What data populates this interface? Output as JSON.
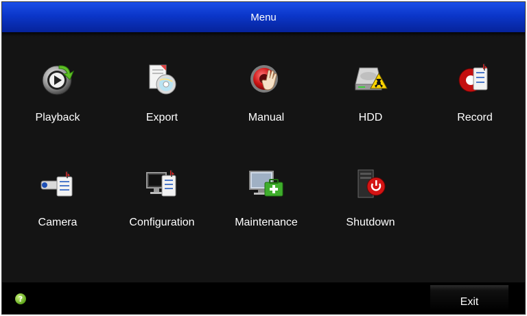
{
  "window": {
    "title": "Menu"
  },
  "menu": {
    "items": [
      {
        "label": "Playback",
        "icon": "playback-icon"
      },
      {
        "label": "Export",
        "icon": "export-icon"
      },
      {
        "label": "Manual",
        "icon": "manual-icon"
      },
      {
        "label": "HDD",
        "icon": "hdd-icon"
      },
      {
        "label": "Record",
        "icon": "record-icon"
      },
      {
        "label": "Camera",
        "icon": "camera-icon"
      },
      {
        "label": "Configuration",
        "icon": "configuration-icon"
      },
      {
        "label": "Maintenance",
        "icon": "maintenance-icon"
      },
      {
        "label": "Shutdown",
        "icon": "shutdown-icon"
      }
    ]
  },
  "footer": {
    "help_icon": "help-icon",
    "help_glyph": "?",
    "exit_label": "Exit"
  },
  "colors": {
    "titlebar": "#0b36c9",
    "background": "#141414",
    "text": "#ffffff"
  }
}
